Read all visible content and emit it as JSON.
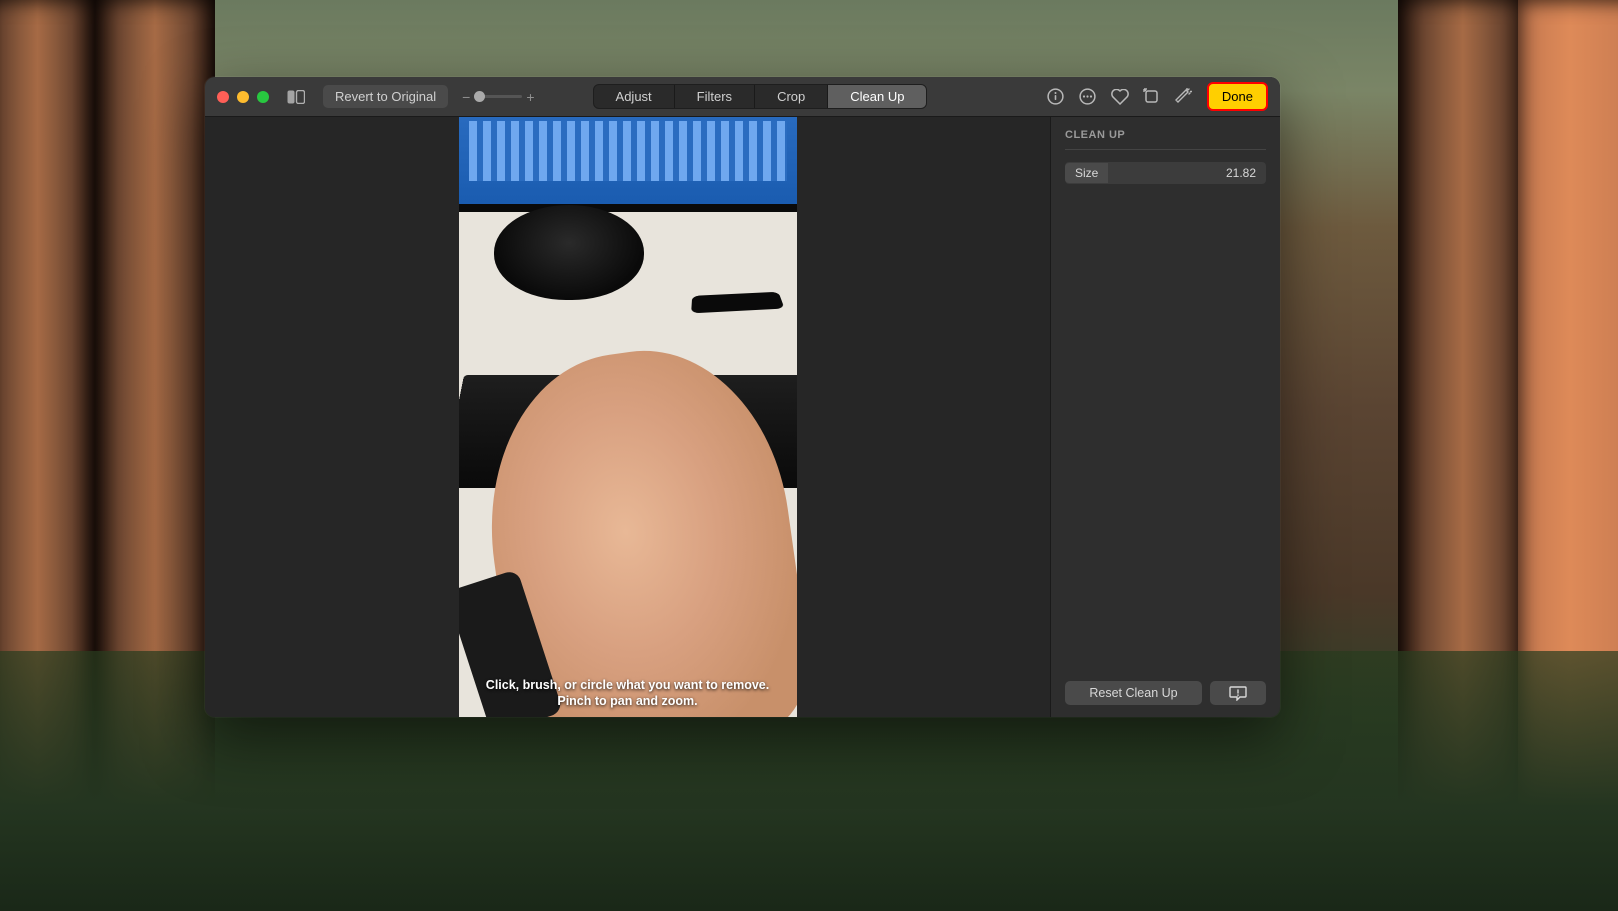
{
  "toolbar": {
    "revert_label": "Revert to Original",
    "zoom_minus": "−",
    "zoom_plus": "+",
    "tabs": {
      "adjust": "Adjust",
      "filters": "Filters",
      "crop": "Crop",
      "cleanup": "Clean Up"
    },
    "done_label": "Done"
  },
  "canvas": {
    "hint_text": "Click, brush, or circle what you want to remove. Pinch to pan and zoom."
  },
  "sidebar": {
    "title": "CLEAN UP",
    "size_label": "Size",
    "size_value": "21.82",
    "reset_label": "Reset Clean Up"
  }
}
